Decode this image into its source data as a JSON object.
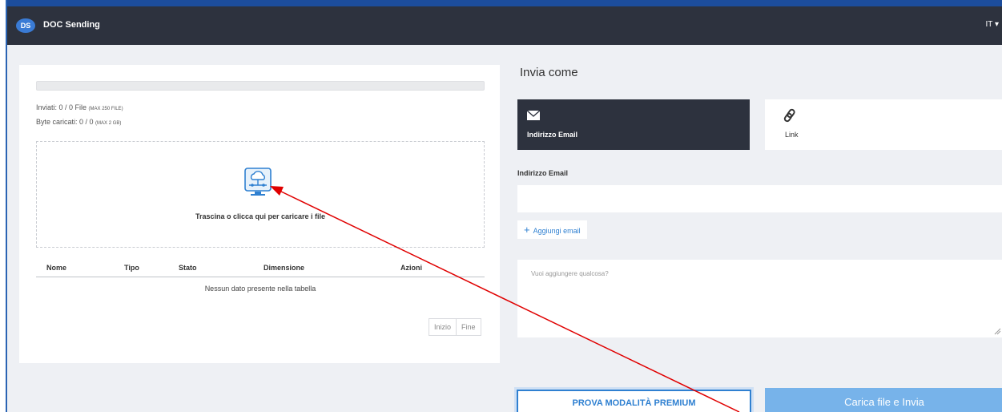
{
  "app": {
    "logo_text": "DS",
    "title": "DOC Sending",
    "language": "IT",
    "language_caret": "▾"
  },
  "upload": {
    "progress_percent": 0,
    "sent_label": "Inviati: 0 / 0 File",
    "sent_limit": "(MAX 250 FILE)",
    "bytes_label": "Byte caricati: 0 / 0",
    "bytes_limit": "(MAX 2 GB)",
    "drop_text": "Trascina o clicca qui per caricare i file",
    "icon": "cloud-upload-icon"
  },
  "table": {
    "columns": [
      "Nome",
      "Tipo",
      "Stato",
      "Dimensione",
      "Azioni"
    ],
    "empty_message": "Nessun dato presente nella tabella",
    "pager": {
      "first": "Inizio",
      "last": "Fine"
    }
  },
  "send": {
    "title": "Invia come",
    "options": [
      {
        "label": "Indirizzo Email",
        "icon": "envelope-icon",
        "selected": true
      },
      {
        "label": "Link",
        "icon": "link-icon",
        "selected": false
      }
    ],
    "email_label": "Indirizzo Email",
    "email_value": "",
    "add_email_label": "Aggiungi email",
    "add_icon": "plus-icon",
    "message_placeholder": "Vuoi aggiungere qualcosa?",
    "premium_button": "PROVA MODALITÀ PREMIUM",
    "submit_button": "Carica file e Invia"
  },
  "colors": {
    "topbar": "#2d323e",
    "accent": "#2f80d1",
    "submit": "#77b3ea",
    "annotation_arrow": "#e00000"
  }
}
